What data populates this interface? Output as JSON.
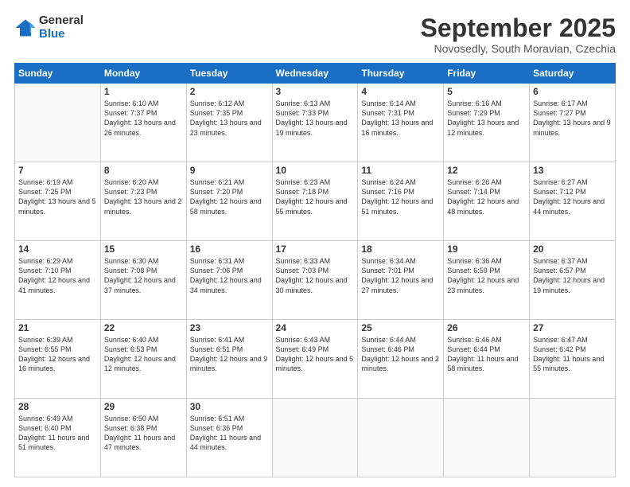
{
  "logo": {
    "general": "General",
    "blue": "Blue"
  },
  "header": {
    "month": "September 2025",
    "location": "Novosedly, South Moravian, Czechia"
  },
  "weekdays": [
    "Sunday",
    "Monday",
    "Tuesday",
    "Wednesday",
    "Thursday",
    "Friday",
    "Saturday"
  ],
  "weeks": [
    [
      {
        "day": "",
        "info": ""
      },
      {
        "day": "1",
        "info": "Sunrise: 6:10 AM\nSunset: 7:37 PM\nDaylight: 13 hours\nand 26 minutes."
      },
      {
        "day": "2",
        "info": "Sunrise: 6:12 AM\nSunset: 7:35 PM\nDaylight: 13 hours\nand 23 minutes."
      },
      {
        "day": "3",
        "info": "Sunrise: 6:13 AM\nSunset: 7:33 PM\nDaylight: 13 hours\nand 19 minutes."
      },
      {
        "day": "4",
        "info": "Sunrise: 6:14 AM\nSunset: 7:31 PM\nDaylight: 13 hours\nand 16 minutes."
      },
      {
        "day": "5",
        "info": "Sunrise: 6:16 AM\nSunset: 7:29 PM\nDaylight: 13 hours\nand 12 minutes."
      },
      {
        "day": "6",
        "info": "Sunrise: 6:17 AM\nSunset: 7:27 PM\nDaylight: 13 hours\nand 9 minutes."
      }
    ],
    [
      {
        "day": "7",
        "info": "Sunrise: 6:19 AM\nSunset: 7:25 PM\nDaylight: 13 hours\nand 5 minutes."
      },
      {
        "day": "8",
        "info": "Sunrise: 6:20 AM\nSunset: 7:23 PM\nDaylight: 13 hours\nand 2 minutes."
      },
      {
        "day": "9",
        "info": "Sunrise: 6:21 AM\nSunset: 7:20 PM\nDaylight: 12 hours\nand 58 minutes."
      },
      {
        "day": "10",
        "info": "Sunrise: 6:23 AM\nSunset: 7:18 PM\nDaylight: 12 hours\nand 55 minutes."
      },
      {
        "day": "11",
        "info": "Sunrise: 6:24 AM\nSunset: 7:16 PM\nDaylight: 12 hours\nand 51 minutes."
      },
      {
        "day": "12",
        "info": "Sunrise: 6:26 AM\nSunset: 7:14 PM\nDaylight: 12 hours\nand 48 minutes."
      },
      {
        "day": "13",
        "info": "Sunrise: 6:27 AM\nSunset: 7:12 PM\nDaylight: 12 hours\nand 44 minutes."
      }
    ],
    [
      {
        "day": "14",
        "info": "Sunrise: 6:29 AM\nSunset: 7:10 PM\nDaylight: 12 hours\nand 41 minutes."
      },
      {
        "day": "15",
        "info": "Sunrise: 6:30 AM\nSunset: 7:08 PM\nDaylight: 12 hours\nand 37 minutes."
      },
      {
        "day": "16",
        "info": "Sunrise: 6:31 AM\nSunset: 7:06 PM\nDaylight: 12 hours\nand 34 minutes."
      },
      {
        "day": "17",
        "info": "Sunrise: 6:33 AM\nSunset: 7:03 PM\nDaylight: 12 hours\nand 30 minutes."
      },
      {
        "day": "18",
        "info": "Sunrise: 6:34 AM\nSunset: 7:01 PM\nDaylight: 12 hours\nand 27 minutes."
      },
      {
        "day": "19",
        "info": "Sunrise: 6:36 AM\nSunset: 6:59 PM\nDaylight: 12 hours\nand 23 minutes."
      },
      {
        "day": "20",
        "info": "Sunrise: 6:37 AM\nSunset: 6:57 PM\nDaylight: 12 hours\nand 19 minutes."
      }
    ],
    [
      {
        "day": "21",
        "info": "Sunrise: 6:39 AM\nSunset: 6:55 PM\nDaylight: 12 hours\nand 16 minutes."
      },
      {
        "day": "22",
        "info": "Sunrise: 6:40 AM\nSunset: 6:53 PM\nDaylight: 12 hours\nand 12 minutes."
      },
      {
        "day": "23",
        "info": "Sunrise: 6:41 AM\nSunset: 6:51 PM\nDaylight: 12 hours\nand 9 minutes."
      },
      {
        "day": "24",
        "info": "Sunrise: 6:43 AM\nSunset: 6:49 PM\nDaylight: 12 hours\nand 5 minutes."
      },
      {
        "day": "25",
        "info": "Sunrise: 6:44 AM\nSunset: 6:46 PM\nDaylight: 12 hours\nand 2 minutes."
      },
      {
        "day": "26",
        "info": "Sunrise: 6:46 AM\nSunset: 6:44 PM\nDaylight: 11 hours\nand 58 minutes."
      },
      {
        "day": "27",
        "info": "Sunrise: 6:47 AM\nSunset: 6:42 PM\nDaylight: 11 hours\nand 55 minutes."
      }
    ],
    [
      {
        "day": "28",
        "info": "Sunrise: 6:49 AM\nSunset: 6:40 PM\nDaylight: 11 hours\nand 51 minutes."
      },
      {
        "day": "29",
        "info": "Sunrise: 6:50 AM\nSunset: 6:38 PM\nDaylight: 11 hours\nand 47 minutes."
      },
      {
        "day": "30",
        "info": "Sunrise: 6:51 AM\nSunset: 6:36 PM\nDaylight: 11 hours\nand 44 minutes."
      },
      {
        "day": "",
        "info": ""
      },
      {
        "day": "",
        "info": ""
      },
      {
        "day": "",
        "info": ""
      },
      {
        "day": "",
        "info": ""
      }
    ]
  ]
}
